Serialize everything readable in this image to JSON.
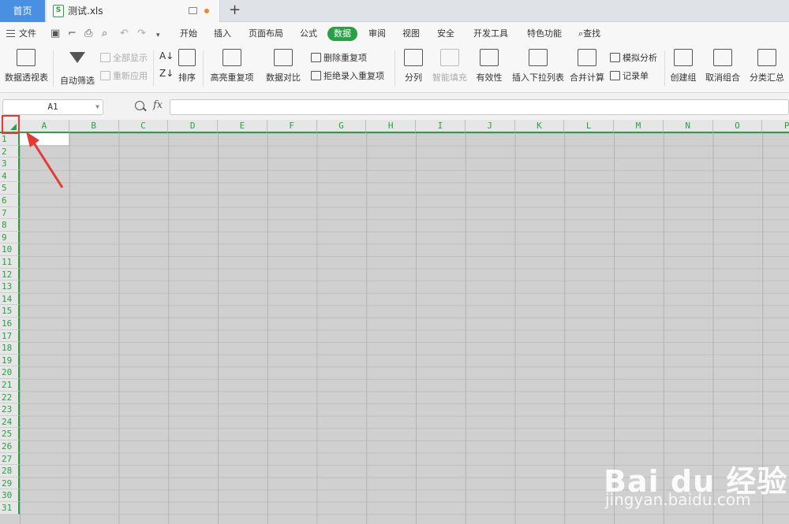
{
  "tabs": {
    "home": "首页",
    "file_name": "测试.xls",
    "file_icon": "S"
  },
  "menu": {
    "file": "文件",
    "items": [
      "开始",
      "插入",
      "页面布局",
      "公式",
      "数据",
      "审阅",
      "视图",
      "安全",
      "开发工具",
      "特色功能"
    ],
    "active": "数据",
    "search": "查找"
  },
  "ribbon": {
    "pivot": "数据透视表",
    "autofilter": "自动筛选",
    "show_all": "全部显示",
    "reapply": "重新应用",
    "sort": "排序",
    "highlight_dup": "高亮重复项",
    "compare": "数据对比",
    "remove_dup": "删除重复项",
    "reject_dup": "拒绝录入重复项",
    "split": "分列",
    "smart_fill": "智能填充",
    "validity": "有效性",
    "dropdown": "插入下拉列表",
    "consolidate": "合并计算",
    "whatif": "模拟分析",
    "record": "记录单",
    "group": "创建组",
    "ungroup": "取消组合",
    "subtotal": "分类汇总"
  },
  "formula_bar": {
    "name_box": "A1",
    "fx": "fx",
    "formula": ""
  },
  "grid": {
    "columns": [
      "A",
      "B",
      "C",
      "D",
      "E",
      "F",
      "G",
      "H",
      "I",
      "J",
      "K",
      "L",
      "M",
      "N",
      "O",
      "P"
    ],
    "rows": [
      "1",
      "2",
      "3",
      "4",
      "5",
      "6",
      "7",
      "8",
      "9",
      "10",
      "11",
      "12",
      "13",
      "14",
      "15",
      "16",
      "17",
      "18",
      "19",
      "20",
      "21",
      "22",
      "23",
      "24",
      "25",
      "26",
      "27",
      "28",
      "29",
      "30",
      "31"
    ]
  },
  "watermark": {
    "logo": "Bai du 经验",
    "url": "jingyan.baidu.com"
  },
  "colors": {
    "accent": "#2aa046",
    "highlight": "#e53935",
    "home_tab": "#4a90e2"
  }
}
